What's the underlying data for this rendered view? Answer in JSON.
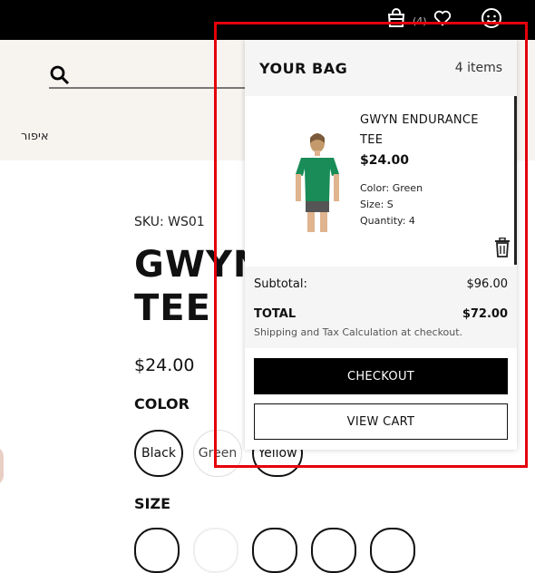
{
  "header": {
    "bag_count": "(4)",
    "nav_link": "איפור"
  },
  "product": {
    "sku": "SKU: WS01",
    "title": "GWYN\nTEE",
    "price": "$24.00",
    "color_label": "COLOR",
    "colors": [
      "Black",
      "Green",
      "Yellow"
    ],
    "size_label": "SIZE"
  },
  "minicart": {
    "title": "YOUR BAG",
    "count": "4 items",
    "item": {
      "name": "GWYN ENDURANCE TEE",
      "price": "$24.00",
      "color": "Color: Green",
      "size": "Size: S",
      "quantity": "Quantity: 4",
      "image_shirt_color": "#1a8c57"
    },
    "subtotal_label": "Subtotal:",
    "subtotal_value": "$96.00",
    "total_label": "TOTAL",
    "total_value": "$72.00",
    "shipping_note": "Shipping and Tax Calculation at checkout.",
    "checkout_label": "CHECKOUT",
    "view_cart_label": "VIEW CART"
  },
  "colors": {
    "highlight": "#e5000a",
    "topbar": "#000000",
    "header_band": "#f7f4f0"
  }
}
